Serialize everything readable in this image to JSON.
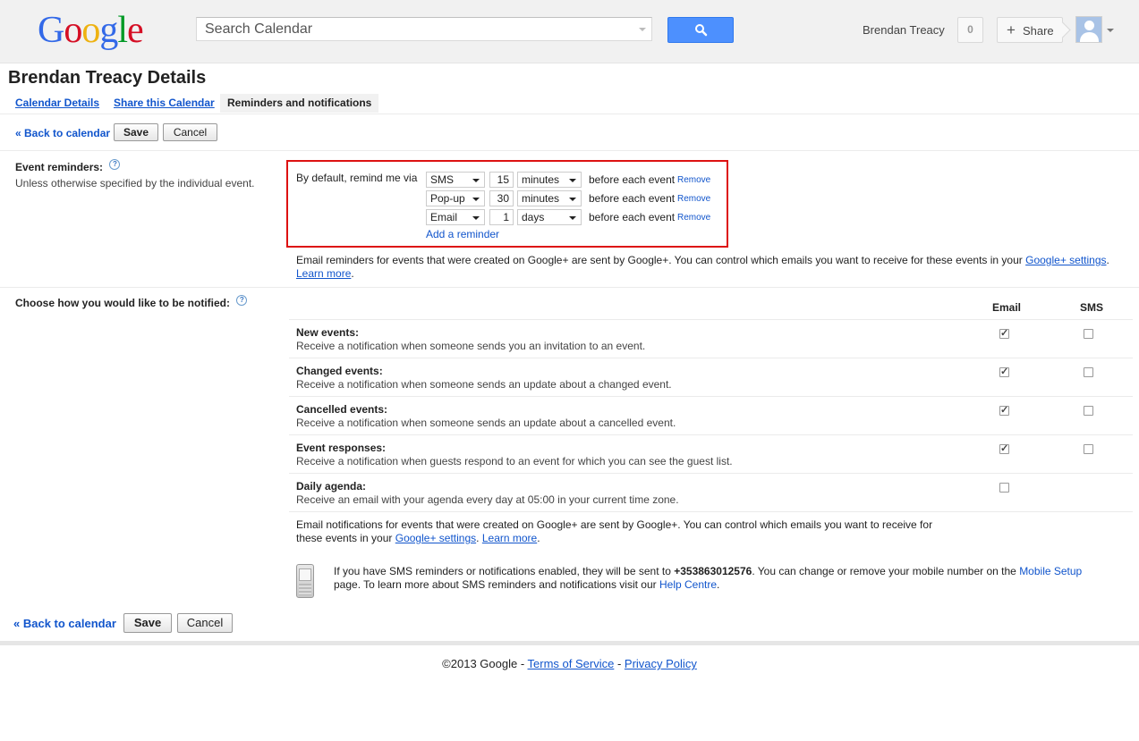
{
  "header": {
    "logo": [
      "G",
      "o",
      "o",
      "g",
      "l",
      "e"
    ],
    "search_placeholder": "Search Calendar",
    "user_name": "Brendan Treacy",
    "notification_count": "0",
    "share_label": "Share"
  },
  "page_title": "Brendan Treacy Details",
  "tabs": [
    {
      "label": "Calendar Details",
      "active": false
    },
    {
      "label": "Share this Calendar",
      "active": false
    },
    {
      "label": "Reminders and notifications",
      "active": true
    }
  ],
  "actions": {
    "back": "« Back to calendar",
    "save": "Save",
    "cancel": "Cancel"
  },
  "event_reminders": {
    "label": "Event reminders:",
    "help": "?",
    "sublabel": "Unless otherwise specified by the individual event.",
    "intro": "By default, remind me via",
    "rows": [
      {
        "method": "SMS",
        "amount": "15",
        "unit": "minutes",
        "suffix": "before each event",
        "remove": "Remove"
      },
      {
        "method": "Pop-up",
        "amount": "30",
        "unit": "minutes",
        "suffix": "before each event",
        "remove": "Remove"
      },
      {
        "method": "Email",
        "amount": "1",
        "unit": "days",
        "suffix": "before each event",
        "remove": "Remove"
      }
    ],
    "add": "Add a reminder",
    "note": "Email reminders for events that were created on Google+ are sent by Google+. You can control which emails you want to receive for these events in your",
    "note_link": "Google+ settings",
    "note_end": ".",
    "learn_more": "Learn more",
    "learn_more_end": "."
  },
  "notifications": {
    "label": "Choose how you would like to be notified:",
    "help": "?",
    "col_email": "Email",
    "col_sms": "SMS",
    "items": [
      {
        "title": "New events:",
        "desc": "Receive a notification when someone sends you an invitation to an event.",
        "email": true,
        "sms": false
      },
      {
        "title": "Changed events:",
        "desc": "Receive a notification when someone sends an update about a changed event.",
        "email": true,
        "sms": false
      },
      {
        "title": "Cancelled events:",
        "desc": "Receive a notification when someone sends an update about a cancelled event.",
        "email": true,
        "sms": false
      },
      {
        "title": "Event responses:",
        "desc": "Receive a notification when guests respond to an event for which you can see the guest list.",
        "email": true,
        "sms": false
      },
      {
        "title": "Daily agenda:",
        "desc": "Receive an email with your agenda every day at 05:00 in your current time zone.",
        "email": false,
        "sms": null
      }
    ],
    "gplus_note_1": "Email notifications for events that were created on Google+ are sent by Google+. You can control which emails you want to receive for",
    "gplus_note_2": "these events in your",
    "gplus_link": "Google+ settings",
    "gplus_sep": ".",
    "learn_more": "Learn more",
    "learn_more_end": ".",
    "sms_note_1": "If you have SMS reminders or notifications enabled, they will be sent to",
    "phone": "+353863012576",
    "sms_note_2": ". You can change or remove your mobile number on the",
    "mobile_setup": "Mobile Setup",
    "sms_note_3": "page. To learn more about SMS reminders and notifications visit our",
    "help_centre": "Help Centre",
    "sms_note_end": "."
  },
  "footer": {
    "copyright": "©2013 Google - ",
    "terms": "Terms of Service",
    "sep": " - ",
    "privacy": "Privacy Policy"
  }
}
